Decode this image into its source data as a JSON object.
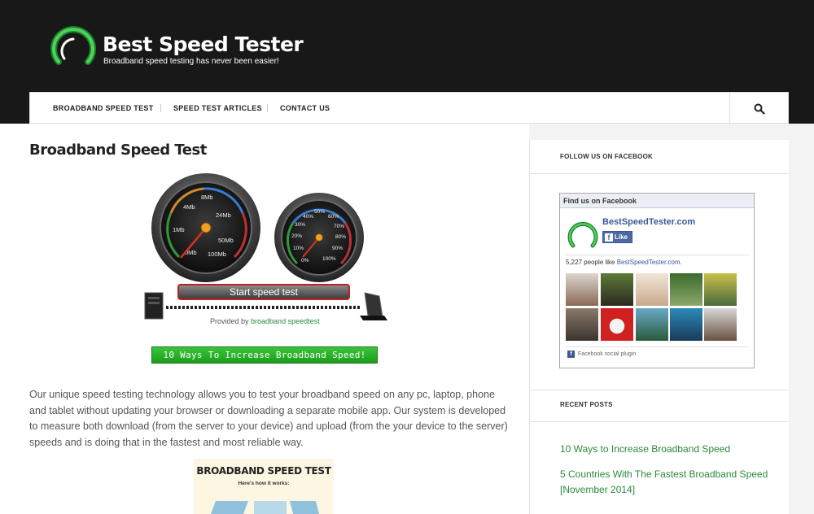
{
  "header": {
    "title": "Best Speed Tester",
    "tagline": "Broadband speed testing has never been easier!"
  },
  "nav": {
    "items": [
      {
        "label": "BROADBAND SPEED TEST"
      },
      {
        "label": "SPEED TEST ARTICLES"
      },
      {
        "label": "CONTACT US"
      }
    ],
    "search_icon": "search-icon"
  },
  "main": {
    "title": "Broadband Speed Test",
    "speedometer": {
      "download_ticks": [
        "0Mb",
        "1Mb",
        "4Mb",
        "8Mb",
        "24Mb",
        "50Mb",
        "100Mb"
      ],
      "percent_ticks": [
        "0%",
        "10%",
        "20%",
        "30%",
        "40%",
        "50%",
        "60%",
        "70%",
        "80%",
        "90%",
        "100%"
      ],
      "start_label": "Start speed test",
      "provided_prefix": "Provided by ",
      "provided_link": "broadband speedtest"
    },
    "cta_button": "10 Ways To Increase Broadband Speed!",
    "intro": "Our unique speed testing technology allows you to test your broadband speed on any pc, laptop, phone and tablet without updating your browser or downloading a separate mobile app. Our system is developed to measure both download (from the server to your device) and upload (from the your device to the server) speeds and is doing that in the fastest and most reliable way.",
    "infographic": {
      "title": "BROADBAND SPEED TEST",
      "subtitle": "Here's how it works:"
    }
  },
  "sidebar": {
    "facebook_widget": {
      "title": "FOLLOW US ON FACEBOOK",
      "box_header": "Find us on Facebook",
      "page_name": "BestSpeedTester.com",
      "like_label": "Like",
      "count_text": "5,227 people like ",
      "count_link": "BestSpeedTester.com.",
      "footer": "Facebook social plugin"
    },
    "recent_posts": {
      "title": "RECENT POSTS",
      "items": [
        {
          "label": "10 Ways to Increase Broadband Speed"
        },
        {
          "label": "5 Countries With The Fastest Broadband Speed [November 2014]"
        }
      ]
    }
  },
  "colors": {
    "header_bg": "#181818",
    "accent_green": "#2a8a3a",
    "facebook_blue": "#3b5998"
  }
}
